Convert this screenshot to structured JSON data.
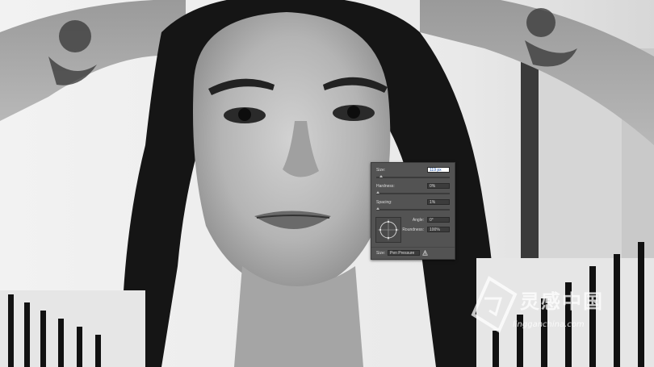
{
  "brush_panel": {
    "size_label": "Size:",
    "size_value": "119 px",
    "hardness_label": "Hardness:",
    "hardness_value": "0%",
    "spacing_label": "Spacing:",
    "spacing_value": "1%",
    "angle_label": "Angle:",
    "angle_value": "0°",
    "roundness_label": "Roundness:",
    "roundness_value": "100%",
    "size_control_label": "Size:",
    "size_control_value": "Pen Pressure",
    "warning_icon": "warning-icon"
  },
  "watermark": {
    "text": "灵感中国",
    "url": "lingganchina.com"
  }
}
